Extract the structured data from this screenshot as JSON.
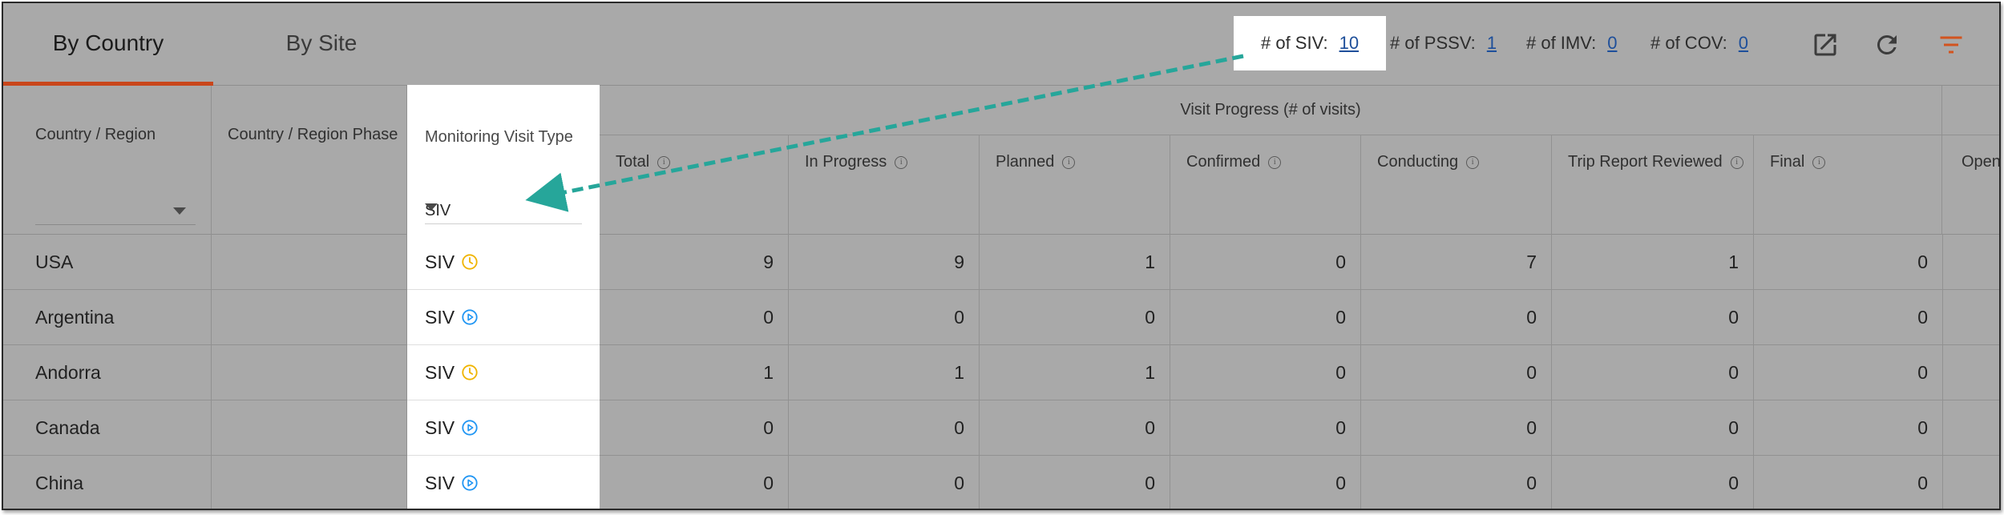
{
  "tabs": {
    "by_country": "By Country",
    "by_site": "By Site"
  },
  "counts": {
    "siv_label": "# of SIV:",
    "siv_value": "10",
    "pssv_label": "# of PSSV:",
    "pssv_value": "1",
    "imv_label": "# of IMV:",
    "imv_value": "0",
    "cov_label": "# of COV:",
    "cov_value": "0"
  },
  "toolbar_icons": [
    "open-in-new-icon",
    "refresh-icon",
    "filter-icon"
  ],
  "colors": {
    "accent": "#c9461b",
    "link": "#1e4f9a",
    "clock_status": "#f0b400",
    "play_status": "#2196f3",
    "arrow": "#26a69a"
  },
  "header": {
    "country": "Country / Region",
    "phase": "Country / Region Phase",
    "visit_type": "Monitoring Visit Type",
    "visit_type_filter": "SIV",
    "group": "Visit Progress (# of visits)",
    "columns": [
      "Total",
      "In Progress",
      "Planned",
      "Confirmed",
      "Conducting",
      "Trip Report Reviewed",
      "Final"
    ],
    "open": "Open"
  },
  "rows": [
    {
      "country": "USA",
      "type": "SIV",
      "icon": "clock-icon",
      "values": [
        "9",
        "9",
        "1",
        "0",
        "7",
        "1",
        "0"
      ]
    },
    {
      "country": "Argentina",
      "type": "SIV",
      "icon": "play-circle-icon",
      "values": [
        "0",
        "0",
        "0",
        "0",
        "0",
        "0",
        "0"
      ]
    },
    {
      "country": "Andorra",
      "type": "SIV",
      "icon": "clock-icon",
      "values": [
        "1",
        "1",
        "1",
        "0",
        "0",
        "0",
        "0"
      ]
    },
    {
      "country": "Canada",
      "type": "SIV",
      "icon": "play-circle-icon",
      "values": [
        "0",
        "0",
        "0",
        "0",
        "0",
        "0",
        "0"
      ]
    },
    {
      "country": "China",
      "type": "SIV",
      "icon": "play-circle-icon",
      "values": [
        "0",
        "0",
        "0",
        "0",
        "0",
        "0",
        "0"
      ]
    }
  ]
}
